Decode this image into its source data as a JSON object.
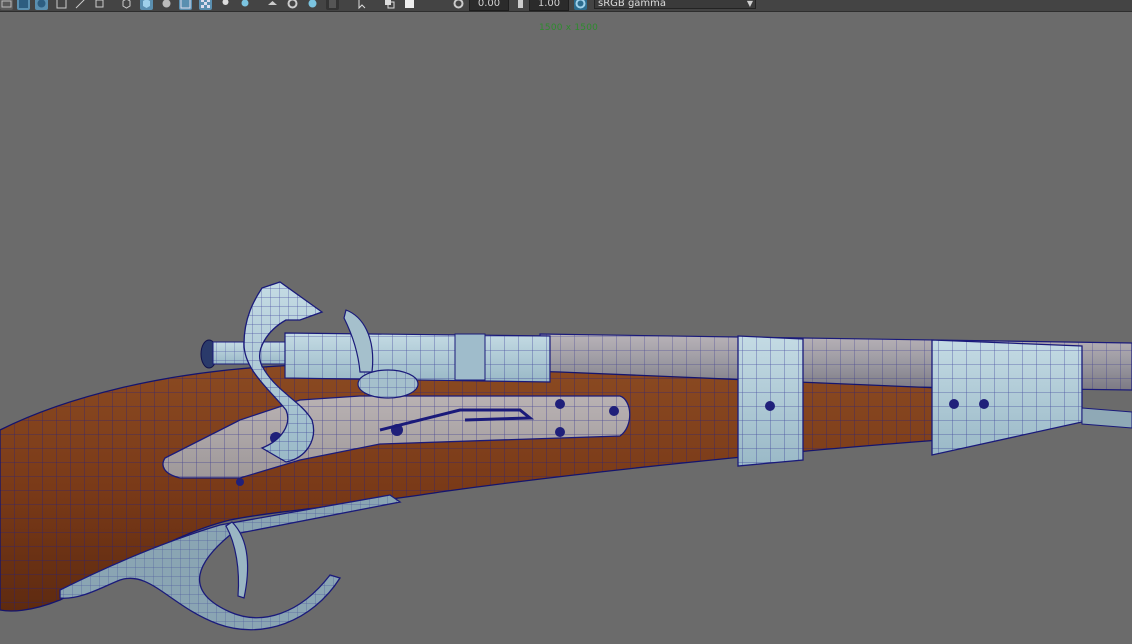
{
  "toolbar": {
    "icons": [
      "grid-toggle-icon",
      "wireframe-shading-icon",
      "smooth-shading-icon",
      "bounding-box-icon",
      "texture-icon",
      "isolate-icon",
      "xray-icon",
      "xray-active-icon",
      "backface-icon",
      "lighting-icon",
      "shadow-icon",
      "ambient-occlusion-icon",
      "motion-blur-icon",
      "antialias-icon",
      "camera-icon",
      "select-camera-icon",
      "film-gate-icon",
      "resolution-gate-icon",
      "safe-action-icon",
      "field-chart-icon",
      "exposure-icon",
      "gamma-icon",
      "color-management-icon"
    ],
    "exposure_value": "0.00",
    "gamma_value": "1.00",
    "colorspace_label": "sRGB gamma"
  },
  "viewport": {
    "resolution_label": "1500 x 1500",
    "model": "flintlock-musket-wireframe"
  },
  "colors": {
    "viewport_bg": "#6b6b6b",
    "wood": "#7a3a18",
    "metal": "#a9c6d3",
    "wireframe": "#1a1a7a",
    "resolution_text": "#2e8b2e"
  }
}
